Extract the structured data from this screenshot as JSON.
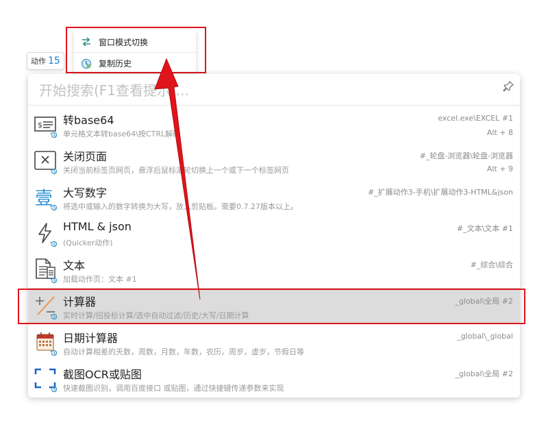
{
  "popup": {
    "items": [
      {
        "label": "窗口模式切换",
        "icon": "swap-arrows-icon"
      },
      {
        "label": "复制历史",
        "icon": "clipboard-history-icon"
      }
    ]
  },
  "badge": {
    "label": "动作",
    "count": "15"
  },
  "search": {
    "placeholder": "开始搜索(F1查看提示)..."
  },
  "actions": [
    {
      "title": "转base64",
      "desc": "单元格文本转base64\\按CTRL解码",
      "source": "excel.exe\\EXCEL #1",
      "hotkey": "Alt + 8",
      "icon": "base64-icon"
    },
    {
      "title": "关闭页面",
      "desc": "关闭当前标签页网页，悬浮后鼠标滚轮切换上一个或下一个标签网页",
      "source": "#_轮盘-浏览器\\轮盘-浏览器",
      "hotkey": "Alt + 9",
      "icon": "close-page-icon"
    },
    {
      "title": "大写数字",
      "desc": "将选中或输入的数字转换为大写，放入剪贴板。需要0.7.27版本以上。",
      "source": "#_扩展动作3-手机\\扩展动作3-HTML&json",
      "hotkey": "",
      "icon": "chinese-numeral-icon"
    },
    {
      "title": "HTML & json",
      "desc": "(Quicker动作)",
      "source": "#_文本\\文本 #1",
      "hotkey": "",
      "icon": "lightning-icon"
    },
    {
      "title": "文本",
      "desc": "加载动作页：文本 #1",
      "source": "#_综合\\综合",
      "hotkey": "",
      "icon": "text-document-icon"
    },
    {
      "title": "计算器",
      "desc": "实时计算/招投标计算/选中自动过滤/历史/大写/日期计算",
      "source": "_global\\全局 #2",
      "hotkey": "",
      "icon": "calculator-icon"
    },
    {
      "title": "日期计算器",
      "desc": "自动计算相差的天数，周数，月数，年数，农历，周岁，虚岁，节假日等",
      "source": "_global\\_global",
      "hotkey": "",
      "icon": "calendar-icon"
    },
    {
      "title": "截图OCR或贴图",
      "desc": "快速截图识别，调用百度接口 或贴图，通过快捷键传递参数来实现",
      "source": "_global\\全局 #2",
      "hotkey": "",
      "icon": "screenshot-ocr-icon"
    }
  ],
  "colors": {
    "accent": "#1f7dd6",
    "highlight": "#e0141b",
    "selected_row": "#dcdcdc"
  }
}
